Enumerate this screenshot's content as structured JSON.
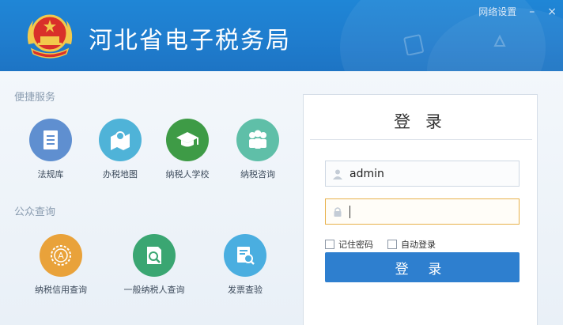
{
  "window": {
    "title": "河北省电子税务局",
    "network_settings": "网络设置",
    "minimize": "–",
    "close": "×"
  },
  "sections": {
    "quick_services": {
      "label": "便捷服务",
      "items": [
        {
          "label": "法规库",
          "icon": "document-icon",
          "color": "#5f8fd0"
        },
        {
          "label": "办税地图",
          "icon": "map-icon",
          "color": "#4fb3d8"
        },
        {
          "label": "纳税人学校",
          "icon": "graduation-cap-icon",
          "color": "#3e9b46"
        },
        {
          "label": "纳税咨询",
          "icon": "people-icon",
          "color": "#5fbfa8"
        }
      ]
    },
    "public_query": {
      "label": "公众查询",
      "items": [
        {
          "label": "纳税信用查询",
          "icon": "credit-badge-icon",
          "color": "#e9a23a"
        },
        {
          "label": "一般纳税人查询",
          "icon": "search-document-icon",
          "color": "#3aa672"
        },
        {
          "label": "发票查验",
          "icon": "invoice-search-icon",
          "color": "#4aaee0"
        }
      ]
    }
  },
  "login": {
    "title": "登 录",
    "username_value": "admin",
    "password_value": "",
    "remember_password": "记住密码",
    "auto_login": "自动登录",
    "submit": "登 录"
  },
  "colors": {
    "header": "#1f80d0",
    "button": "#2e7fcf",
    "active_field_border": "#e8b14a"
  }
}
